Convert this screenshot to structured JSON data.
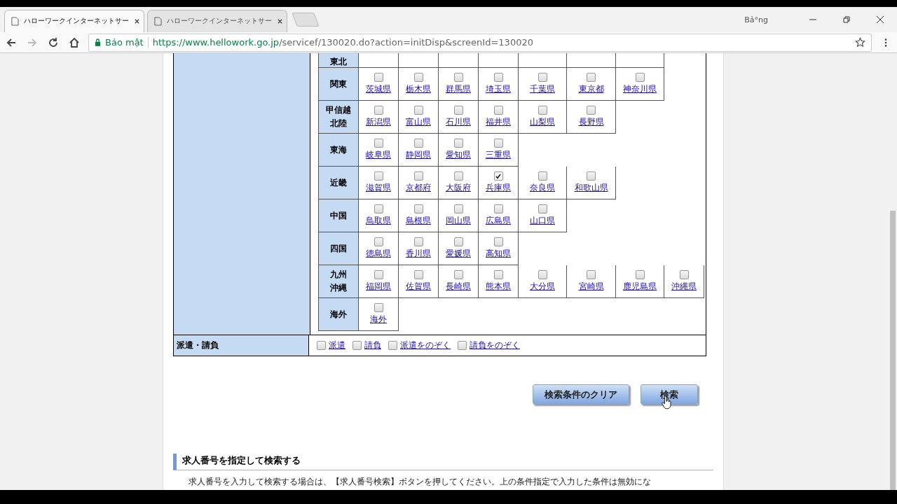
{
  "tabs": [
    {
      "title": "ハローワークインターネットサー",
      "selected": true
    },
    {
      "title": "ハローワークインターネットサー",
      "selected": false
    }
  ],
  "window": {
    "user": "Bả°ng"
  },
  "address": {
    "security": "Bảo mật",
    "host": "https://www.hellowork.go.jp",
    "path": "/servicef/130020.do?action=initDisp&screenId=130020"
  },
  "regions": [
    {
      "name": [
        "東北"
      ],
      "kind": "cut"
    },
    {
      "name": [
        "関東"
      ],
      "kind": "full",
      "prefectures": [
        {
          "name": "茨城県",
          "checked": false
        },
        {
          "name": "栃木県",
          "checked": false
        },
        {
          "name": "群馬県",
          "checked": false
        },
        {
          "name": "埼玉県",
          "checked": false
        },
        {
          "name": "千葉県",
          "checked": false
        },
        {
          "name": "東京都",
          "checked": false
        },
        {
          "name": "神奈川県",
          "checked": false
        }
      ]
    },
    {
      "name": [
        "甲信越",
        "北陸"
      ],
      "kind": "full",
      "prefectures": [
        {
          "name": "新潟県",
          "checked": false
        },
        {
          "name": "富山県",
          "checked": false
        },
        {
          "name": "石川県",
          "checked": false
        },
        {
          "name": "福井県",
          "checked": false
        },
        {
          "name": "山梨県",
          "checked": false
        },
        {
          "name": "長野県",
          "checked": false
        }
      ]
    },
    {
      "name": [
        "東海"
      ],
      "kind": "full",
      "prefectures": [
        {
          "name": "岐阜県",
          "checked": false
        },
        {
          "name": "静岡県",
          "checked": false
        },
        {
          "name": "愛知県",
          "checked": false
        },
        {
          "name": "三重県",
          "checked": false
        }
      ]
    },
    {
      "name": [
        "近畿"
      ],
      "kind": "full",
      "prefectures": [
        {
          "name": "滋賀県",
          "checked": false
        },
        {
          "name": "京都府",
          "checked": false
        },
        {
          "name": "大阪府",
          "checked": false
        },
        {
          "name": "兵庫県",
          "checked": true
        },
        {
          "name": "奈良県",
          "checked": false
        },
        {
          "name": "和歌山県",
          "checked": false
        }
      ]
    },
    {
      "name": [
        "中国"
      ],
      "kind": "full",
      "prefectures": [
        {
          "name": "鳥取県",
          "checked": false
        },
        {
          "name": "島根県",
          "checked": false
        },
        {
          "name": "岡山県",
          "checked": false
        },
        {
          "name": "広島県",
          "checked": false
        },
        {
          "name": "山口県",
          "checked": false
        }
      ]
    },
    {
      "name": [
        "四国"
      ],
      "kind": "full",
      "prefectures": [
        {
          "name": "徳島県",
          "checked": false
        },
        {
          "name": "香川県",
          "checked": false
        },
        {
          "name": "愛媛県",
          "checked": false
        },
        {
          "name": "高知県",
          "checked": false
        }
      ]
    },
    {
      "name": [
        "九州",
        "沖縄"
      ],
      "kind": "full",
      "prefectures": [
        {
          "name": "福岡県",
          "checked": false
        },
        {
          "name": "佐賀県",
          "checked": false
        },
        {
          "name": "長崎県",
          "checked": false
        },
        {
          "name": "熊本県",
          "checked": false
        },
        {
          "name": "大分県",
          "checked": false
        },
        {
          "name": "宮崎県",
          "checked": false
        },
        {
          "name": "鹿児島県",
          "checked": false
        },
        {
          "name": "沖縄県",
          "checked": false
        }
      ]
    },
    {
      "name": [
        "海外"
      ],
      "kind": "full",
      "prefectures": [
        {
          "name": "海外",
          "checked": false
        }
      ]
    }
  ],
  "dispatch": {
    "label": "派遣・請負",
    "options": [
      {
        "name": "派遣",
        "checked": false
      },
      {
        "name": "請負",
        "checked": false
      },
      {
        "name": "派遣をのぞく",
        "checked": false
      },
      {
        "name": "請負をのぞく",
        "checked": false
      }
    ]
  },
  "buttons": [
    "検索条件のクリア",
    "検索"
  ],
  "section": {
    "heading": "求人番号を指定して検索する",
    "text": "求人番号を入力して検索する場合は、【求人番号検索】ボタンを押してください。上の条件指定で入力した条件は無効にな"
  }
}
